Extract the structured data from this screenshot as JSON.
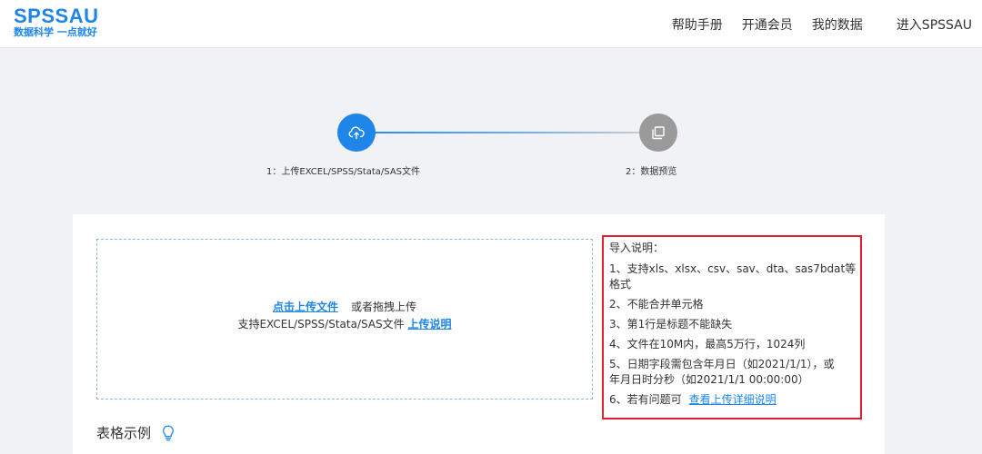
{
  "header": {
    "logo_main": "SPSSAU",
    "logo_sub": "数据科学 一点就好",
    "nav": [
      "帮助手册",
      "开通会员",
      "我的数据"
    ],
    "enter": "进入SPSSAU"
  },
  "steps": {
    "step1": "1：上传EXCEL/SPSS/Stata/SAS文件",
    "step2": "2：数据预览",
    "step1_icon": "cloud-upload-icon",
    "step2_icon": "copy-icon"
  },
  "upload": {
    "click_upload": "点击上传文件",
    "drag": "或者拖拽上传",
    "support": "支持EXCEL/SPSS/Stata/SAS文件",
    "explain_link": "上传说明"
  },
  "notes": {
    "title": "导入说明：",
    "item1": "1、支持xls、xlsx、csv、sav、dta、sas7bdat等格式",
    "item2": "2、不能合并单元格",
    "item3": "3、第1行是标题不能缺失",
    "item4": "4、文件在10M内，最高5万行，1024列",
    "item5a": "5、日期字段需包含年月日（如2021/1/1），或",
    "item5b": "年月日时分秒（如2021/1/1 00:00:00）",
    "item6": "6、若有问题可",
    "item6_link": "查看上传详细说明"
  },
  "example": {
    "label": "表格示例",
    "icon": "lightbulb-icon"
  },
  "colors": {
    "accent": "#1e86e8",
    "highlight_border": "#d9232e",
    "inactive_step": "#9a9a9a"
  }
}
